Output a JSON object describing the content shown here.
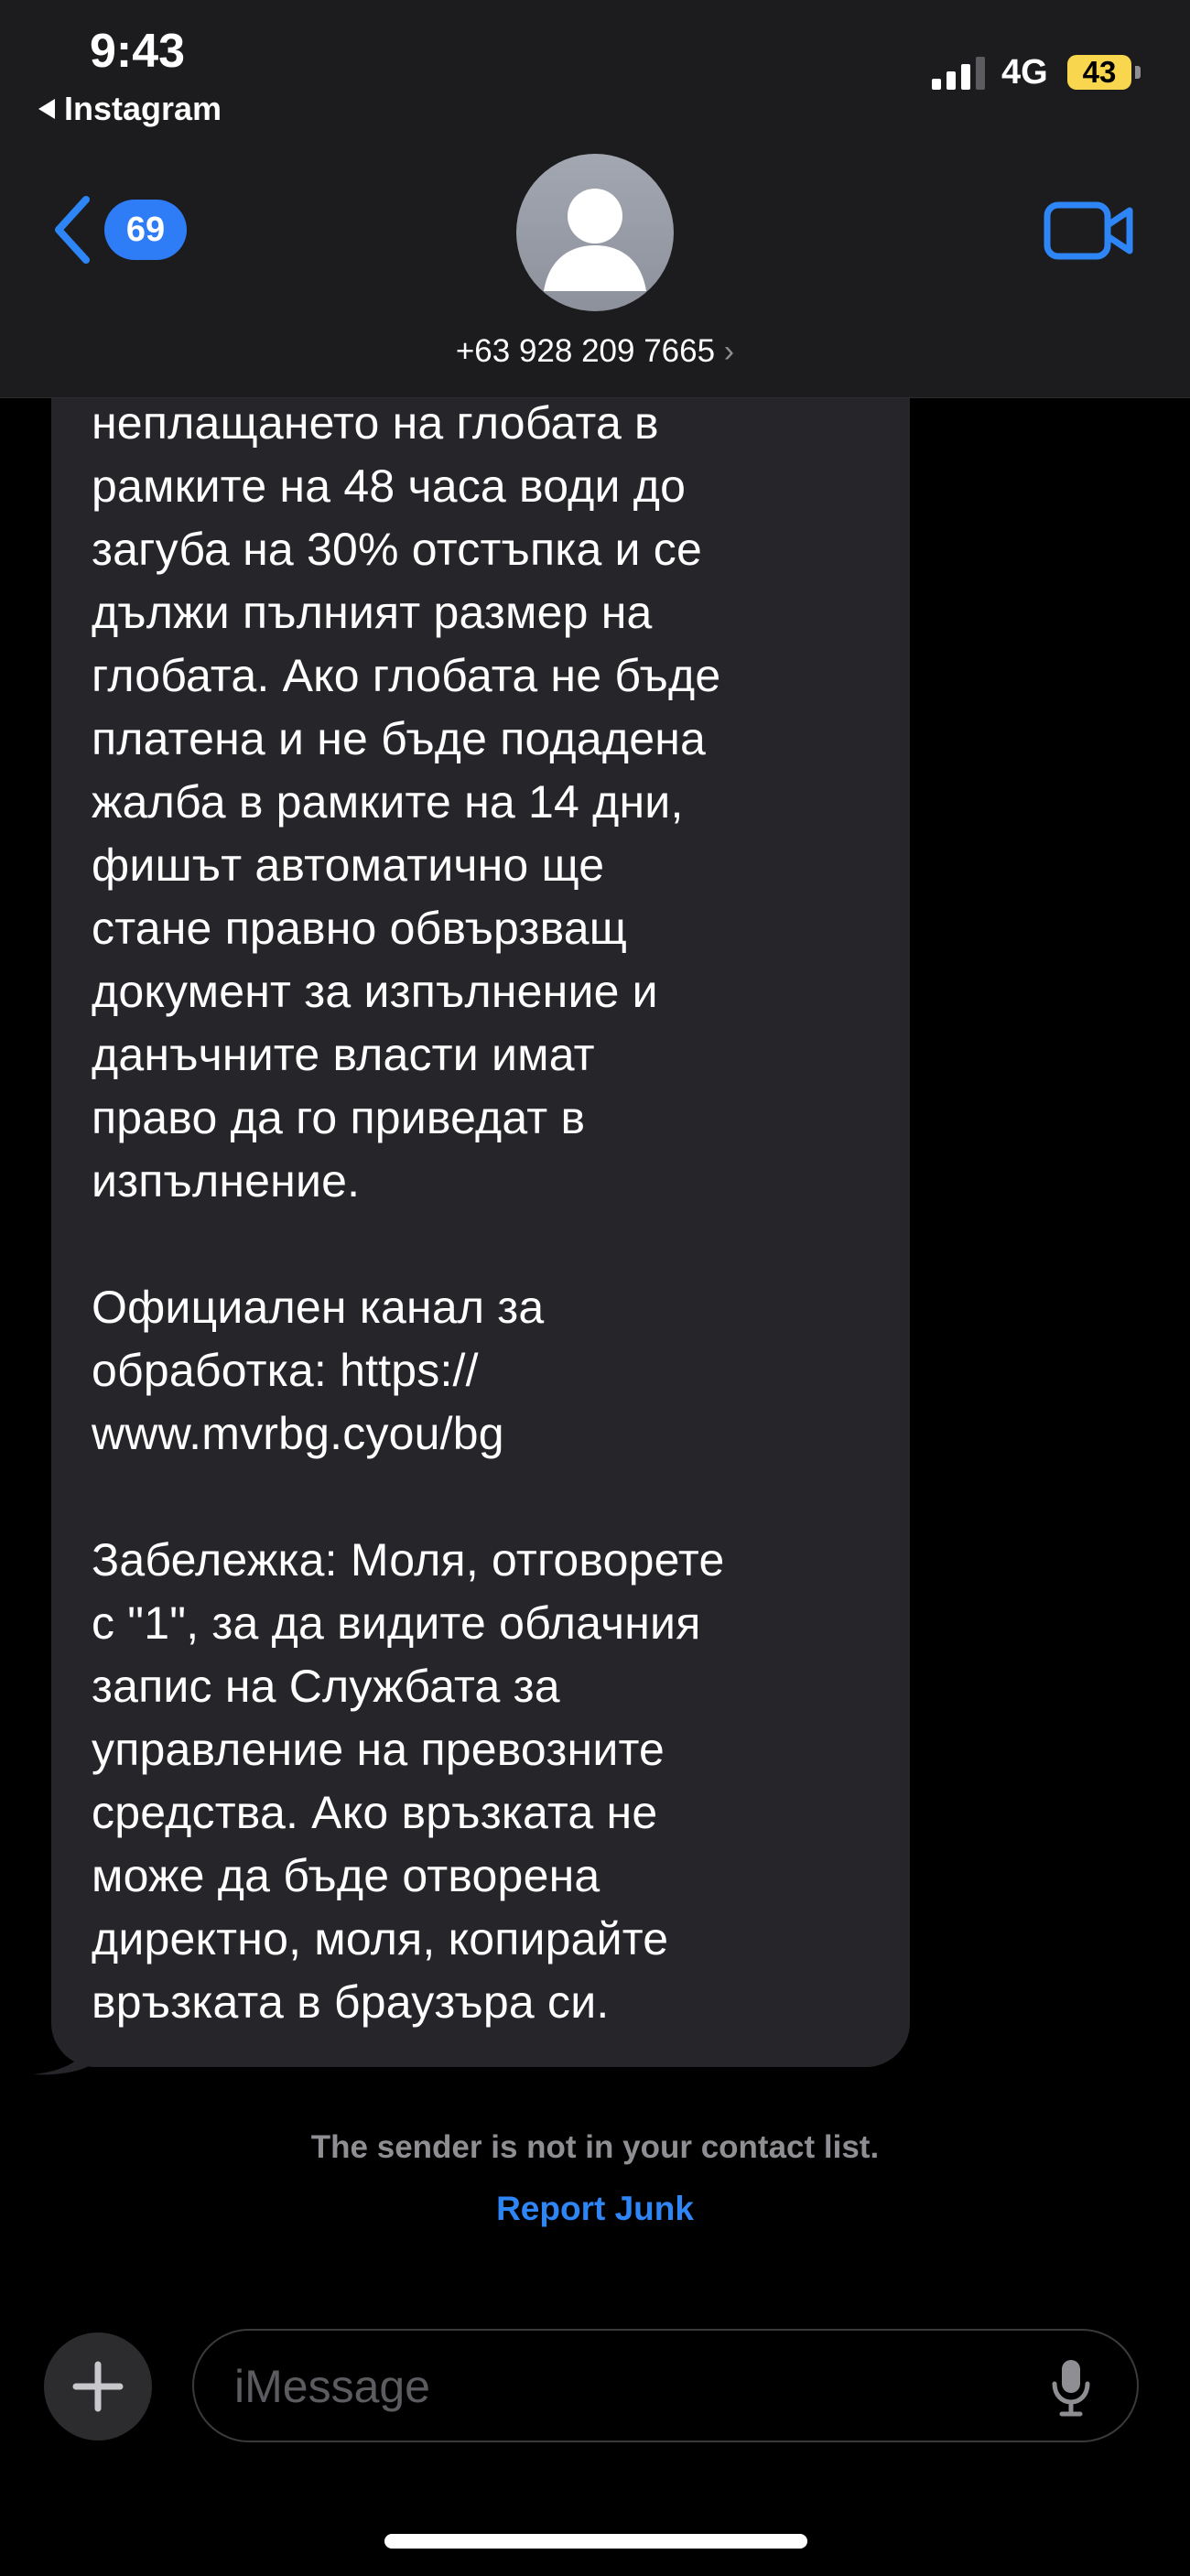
{
  "status_bar": {
    "time": "9:43",
    "back_app": "Instagram",
    "network": "4G",
    "battery": "43"
  },
  "header": {
    "unread_count": "69",
    "contact": "+63 928 209 7665",
    "contact_chevron": "›"
  },
  "message": {
    "text": "неплащането на глобата в\nрамките на 48 часа води до\nзагуба на 30% отстъпка и се\nдължи пълният размер на\nглобата. Ако глобата не бъде\nплатена и не бъде подадена\nжалба в рамките на 14 дни,\nфишът автоматично ще\nстане правно обвързващ\nдокумент за изпълнение и\nданъчните власти имат\nправо да го приведат в\nизпълнение.\n\nОфициален канал за\nобработка: https://\nwww.mvrbg.cyou/bg\n\nЗабележка: Моля, отговорете\nс \"1\", за да видите облачния\nзапис на Службата за\nуправление на превозните\nсредства. Ако връзката не\nможе да бъде отворена\nдиректно, моля, копирайте\nвръзката в браузъра си."
  },
  "notice": {
    "sender_note": "The sender is not in your contact list.",
    "report_junk": "Report Junk"
  },
  "composer": {
    "placeholder": "iMessage"
  },
  "colors": {
    "accent": "#2e86f6",
    "bubble": "#26252a",
    "battery": "#f8d64e"
  },
  "icons": [
    "back-chevron-icon",
    "signal-icon",
    "person-avatar-icon",
    "video-camera-icon",
    "plus-icon",
    "microphone-icon"
  ]
}
